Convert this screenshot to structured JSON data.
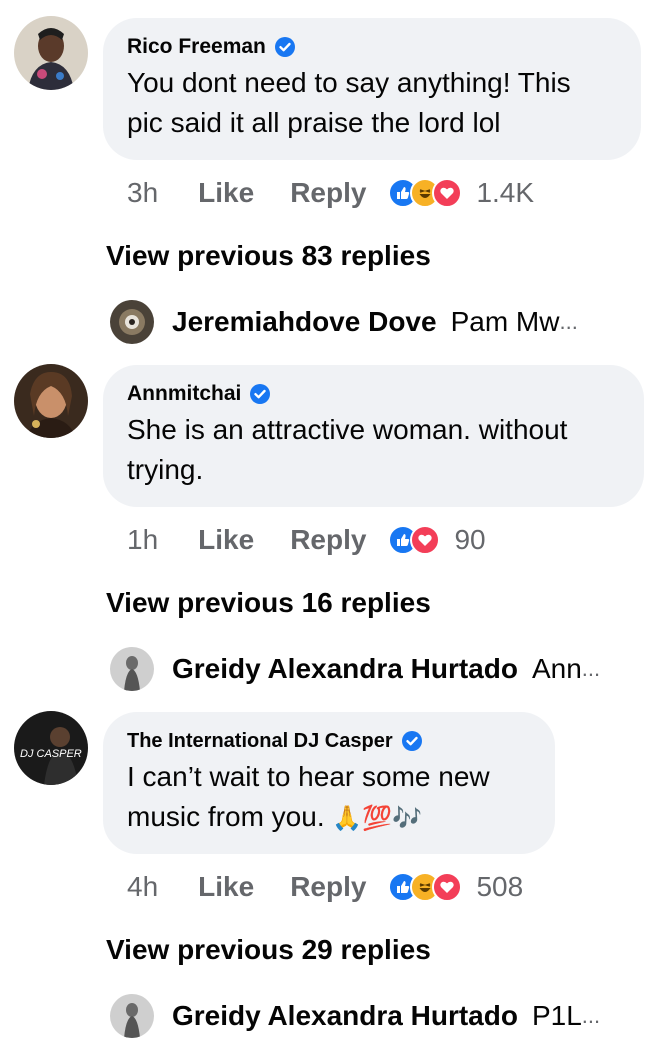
{
  "comments": [
    {
      "author": "Rico Freeman",
      "text_line1": "You dont need to say anything! This",
      "text_line2": "pic said it all praise the lord lol",
      "time": "3h",
      "like_label": "Like",
      "reply_label": "Reply",
      "reactions": [
        "like-icon",
        "haha-icon",
        "love-icon"
      ],
      "reaction_count": "1.4K",
      "view_previous": "View previous 83 replies",
      "reply_preview": {
        "name": "Jeremiahdove Dove",
        "snippet": "Pam Mw",
        "ellipsis": "..."
      }
    },
    {
      "author": "Annmitchai",
      "text_line1": "She is an attractive woman. without",
      "text_line2": "trying.",
      "time": "1h",
      "like_label": "Like",
      "reply_label": "Reply",
      "reactions": [
        "like-icon",
        "love-icon"
      ],
      "reaction_count": "90",
      "view_previous": "View previous 16 replies",
      "reply_preview": {
        "name": "Greidy Alexandra Hurtado",
        "snippet": "Ann",
        "ellipsis": "..."
      }
    },
    {
      "author": "The International DJ Casper",
      "text_line1": "I can’t wait to hear some new",
      "text_line2": "music from you.",
      "text_emoji": "🙏💯🎶",
      "time": "4h",
      "like_label": "Like",
      "reply_label": "Reply",
      "reactions": [
        "like-icon",
        "haha-icon",
        "love-icon"
      ],
      "reaction_count": "508",
      "view_previous": "View previous 29 replies",
      "reply_preview": {
        "name": "Greidy Alexandra Hurtado",
        "snippet": "P1L",
        "ellipsis": "..."
      }
    }
  ],
  "colors": {
    "bubble": "#f0f2f5",
    "secondary_text": "#65676b",
    "verified": "#1877f2",
    "like": "#1877f2",
    "haha": "#f7b125",
    "love": "#f33e58"
  }
}
